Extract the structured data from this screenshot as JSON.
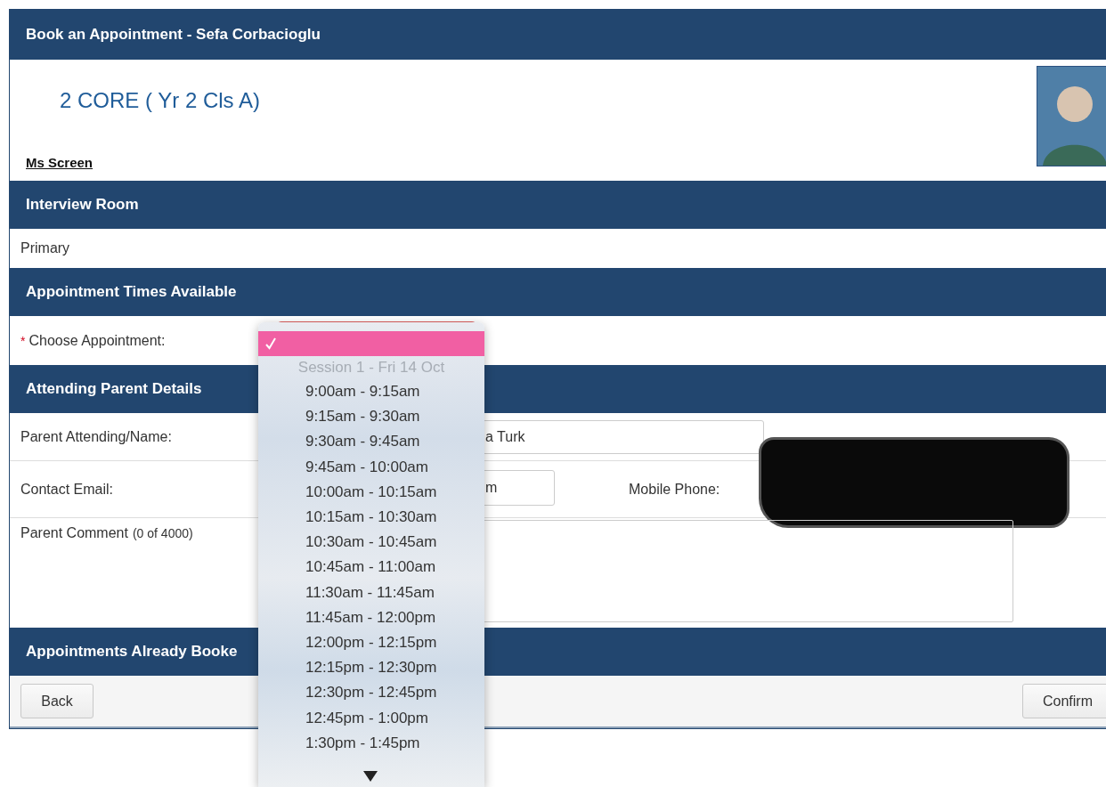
{
  "window": {
    "title": "Book an Appointment - Sefa Corbacioglu"
  },
  "class_title": "2 CORE ( Yr 2 Cls A)",
  "teacher": "Ms Screen",
  "interview_room": {
    "heading": "Interview Room",
    "value": "Primary"
  },
  "appointment_times": {
    "heading": "Appointment Times Available",
    "required_mark": "*",
    "label": "Choose Appointment:"
  },
  "parent_details": {
    "heading": "Attending Parent Details",
    "name": {
      "label": "Parent Attending/Name:",
      "value": "a Turk"
    },
    "email": {
      "label": "Contact Email:",
      "value": "m"
    },
    "mobile": {
      "label": "Mobile Phone:",
      "redacted": true
    },
    "comment": {
      "label": "Parent Comment",
      "count": "(0 of 4000)"
    }
  },
  "booked": {
    "heading": "Appointments Already Booke"
  },
  "buttons": {
    "back": "Back",
    "confirm": "Confirm"
  },
  "dropdown": {
    "more_below": true,
    "options": [
      {
        "kind": "blank",
        "selected": true
      },
      {
        "kind": "group",
        "label": "Session 1 - Fri 14 Oct"
      },
      {
        "kind": "option",
        "label": "9:00am - 9:15am",
        "selected": false
      },
      {
        "kind": "option",
        "label": "9:15am - 9:30am",
        "selected": false
      },
      {
        "kind": "option",
        "label": "9:30am - 9:45am",
        "selected": false
      },
      {
        "kind": "option",
        "label": "9:45am - 10:00am",
        "selected": false
      },
      {
        "kind": "option",
        "label": "10:00am - 10:15am",
        "selected": false
      },
      {
        "kind": "option",
        "label": "10:15am - 10:30am",
        "selected": false
      },
      {
        "kind": "option",
        "label": "10:30am - 10:45am",
        "selected": false
      },
      {
        "kind": "option",
        "label": "10:45am - 11:00am",
        "selected": false
      },
      {
        "kind": "option",
        "label": "11:30am - 11:45am",
        "selected": false
      },
      {
        "kind": "option",
        "label": "11:45am - 12:00pm",
        "selected": false
      },
      {
        "kind": "option",
        "label": "12:00pm - 12:15pm",
        "selected": false
      },
      {
        "kind": "option",
        "label": "12:15pm - 12:30pm",
        "selected": false
      },
      {
        "kind": "option",
        "label": "12:30pm - 12:45pm",
        "selected": false
      },
      {
        "kind": "option",
        "label": "12:45pm - 1:00pm",
        "selected": false
      },
      {
        "kind": "option",
        "label": "1:30pm - 1:45pm",
        "selected": false
      }
    ]
  }
}
